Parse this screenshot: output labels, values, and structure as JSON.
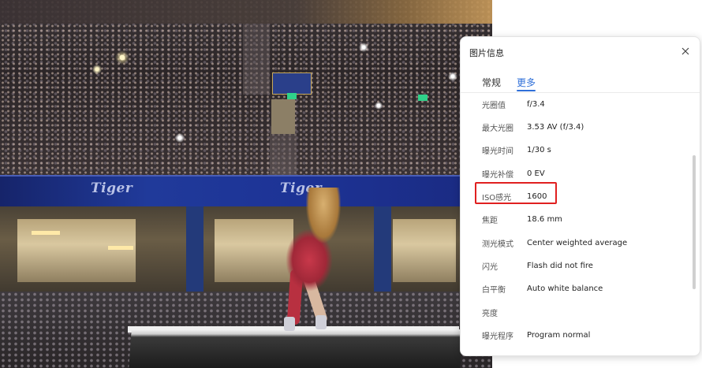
{
  "panel": {
    "title": "图片信息",
    "close_icon": "close-icon",
    "tabs": [
      {
        "label": "常规",
        "active": false
      },
      {
        "label": "更多",
        "active": true
      }
    ],
    "rows": [
      {
        "key": "光圈值",
        "value": "f/3.4"
      },
      {
        "key": "最大光圈",
        "value": "3.53 AV (f/3.4)"
      },
      {
        "key": "曝光时间",
        "value": "1/30 s"
      },
      {
        "key": "曝光补偿",
        "value": "0 EV"
      },
      {
        "key": "ISO感光",
        "value": "1600"
      },
      {
        "key": "焦距",
        "value": "18.6 mm"
      },
      {
        "key": "测光模式",
        "value": "Center weighted average"
      },
      {
        "key": "闪光",
        "value": "Flash did not fire"
      },
      {
        "key": "白平衡",
        "value": "Auto white balance"
      },
      {
        "key": "亮度",
        "value": ""
      },
      {
        "key": "曝光程序",
        "value": "Program normal"
      }
    ],
    "accent_color": "#2f6fd8",
    "highlight_color": "#e02020"
  },
  "photo": {
    "banner_text": "Tiger"
  }
}
